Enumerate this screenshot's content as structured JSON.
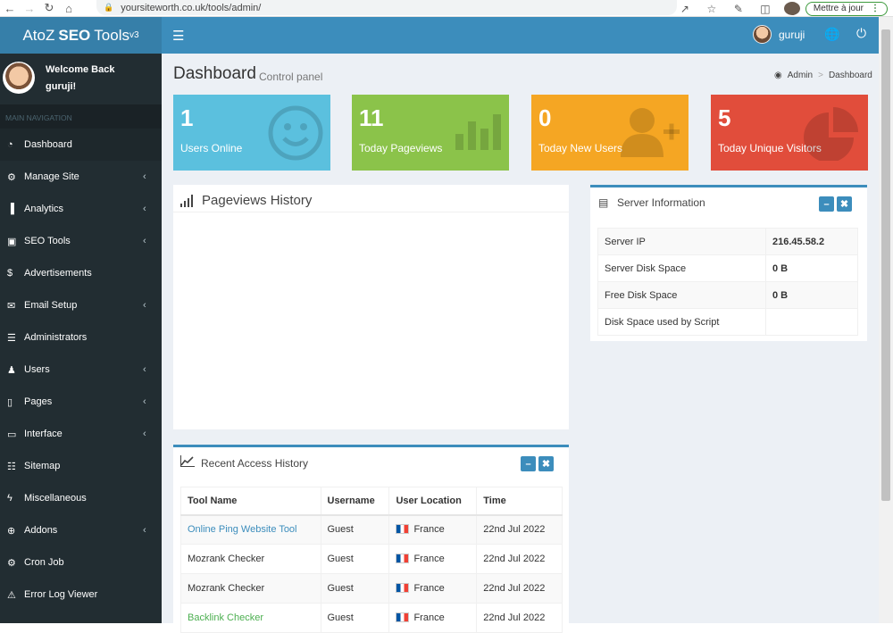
{
  "browser": {
    "url": "yoursiteworth.co.uk/tools/admin/",
    "update_label": "Mettre à jour"
  },
  "app": {
    "logo_pre": "AtoZ",
    "logo_bold": "SEO",
    "logo_post": "Tools",
    "logo_version": "v3",
    "username": "guruji"
  },
  "sidebar": {
    "welcome": "Welcome Back",
    "user": "guruji!",
    "header": "MAIN NAVIGATION",
    "items": [
      {
        "label": "Dashboard",
        "icon": "dashboard-icon",
        "chev": false
      },
      {
        "label": "Manage Site",
        "icon": "cogs-icon",
        "chev": true
      },
      {
        "label": "Analytics",
        "icon": "bar-chart-icon",
        "chev": true
      },
      {
        "label": "SEO Tools",
        "icon": "cube-icon",
        "chev": true
      },
      {
        "label": "Advertisements",
        "icon": "dollar-icon",
        "chev": false
      },
      {
        "label": "Email Setup",
        "icon": "envelope-icon",
        "chev": true
      },
      {
        "label": "Administrators",
        "icon": "list-icon",
        "chev": false
      },
      {
        "label": "Users",
        "icon": "users-icon",
        "chev": true
      },
      {
        "label": "Pages",
        "icon": "file-icon",
        "chev": true
      },
      {
        "label": "Interface",
        "icon": "desktop-icon",
        "chev": true
      },
      {
        "label": "Sitemap",
        "icon": "sitemap-icon",
        "chev": false
      },
      {
        "label": "Miscellaneous",
        "icon": "bolt-icon",
        "chev": false
      },
      {
        "label": "Addons",
        "icon": "plus-circle-icon",
        "chev": true
      },
      {
        "label": "Cron Job",
        "icon": "cogs-icon",
        "chev": false
      },
      {
        "label": "Error Log Viewer",
        "icon": "warning-icon",
        "chev": false
      }
    ]
  },
  "page": {
    "title": "Dashboard",
    "subtitle": "Control panel",
    "breadcrumb_home": "Admin",
    "breadcrumb_current": "Dashboard"
  },
  "stats": [
    {
      "value": "1",
      "label": "Users Online",
      "color": "#5bc0de",
      "icon": "smile-icon"
    },
    {
      "value": "11",
      "label": "Today Pageviews",
      "color": "#8bc34a",
      "icon": "bar-chart-icon"
    },
    {
      "value": "0",
      "label": "Today New Users",
      "color": "#f5a623",
      "icon": "user-plus-icon"
    },
    {
      "value": "5",
      "label": "Today Unique Visitors",
      "color": "#e14d3b",
      "icon": "pie-chart-icon"
    }
  ],
  "pageviews": {
    "title": "Pageviews History"
  },
  "server": {
    "title": "Server Information",
    "rows": [
      {
        "label": "Server IP",
        "value": "216.45.58.2"
      },
      {
        "label": "Server Disk Space",
        "value": "0 B"
      },
      {
        "label": "Free Disk Space",
        "value": "0 B"
      },
      {
        "label": "Disk Space used by Script",
        "value": ""
      }
    ]
  },
  "access": {
    "title": "Recent Access History",
    "columns": [
      "Tool Name",
      "Username",
      "User Location",
      "Time"
    ],
    "rows": [
      {
        "tool": "Online Ping Website Tool",
        "user": "Guest",
        "location": "France",
        "time": "22nd Jul 2022",
        "tool_color": "blue"
      },
      {
        "tool": "Mozrank Checker",
        "user": "Guest",
        "location": "France",
        "time": "22nd Jul 2022",
        "tool_color": "default"
      },
      {
        "tool": "Mozrank Checker",
        "user": "Guest",
        "location": "France",
        "time": "22nd Jul 2022",
        "tool_color": "default"
      },
      {
        "tool": "Backlink Checker",
        "user": "Guest",
        "location": "France",
        "time": "22nd Jul 2022",
        "tool_color": "green"
      }
    ]
  }
}
